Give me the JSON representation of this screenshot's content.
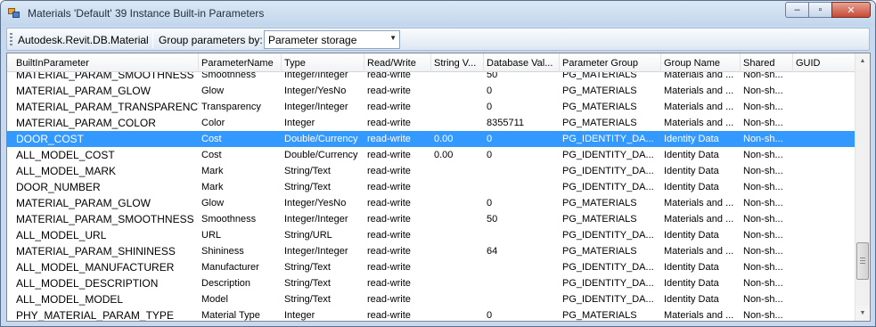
{
  "window": {
    "title": "Materials 'Default' 39 Instance Built-in Parameters",
    "minimize_glyph": "‒",
    "maximize_glyph": "▫",
    "close_glyph": "✕"
  },
  "toolbar": {
    "class_label": "Autodesk.Revit.DB.Material",
    "group_label": "Group parameters by:",
    "group_value": "Parameter storage"
  },
  "grid": {
    "columns": [
      "BuiltInParameter",
      "ParameterName",
      "Type",
      "Read/Write",
      "String V...",
      "Database Val...",
      "Parameter Group",
      "Group Name",
      "Shared",
      "GUID"
    ],
    "selected_row_index": 4,
    "rows": [
      [
        "MATERIAL_PARAM_SMOOTHNESS",
        "Smoothness",
        "Integer/Integer",
        "read-write",
        "",
        "50",
        "PG_MATERIALS",
        "Materials and ...",
        "Non-sh...",
        ""
      ],
      [
        "MATERIAL_PARAM_GLOW",
        "Glow",
        "Integer/YesNo",
        "read-write",
        "",
        "0",
        "PG_MATERIALS",
        "Materials and ...",
        "Non-sh...",
        ""
      ],
      [
        "MATERIAL_PARAM_TRANSPARENCY",
        "Transparency",
        "Integer/Integer",
        "read-write",
        "",
        "0",
        "PG_MATERIALS",
        "Materials and ...",
        "Non-sh...",
        ""
      ],
      [
        "MATERIAL_PARAM_COLOR",
        "Color",
        "Integer",
        "read-write",
        "",
        "8355711",
        "PG_MATERIALS",
        "Materials and ...",
        "Non-sh...",
        ""
      ],
      [
        "DOOR_COST",
        "Cost",
        "Double/Currency",
        "read-write",
        "0.00",
        "0",
        "PG_IDENTITY_DA...",
        "Identity Data",
        "Non-sh...",
        ""
      ],
      [
        "ALL_MODEL_COST",
        "Cost",
        "Double/Currency",
        "read-write",
        "0.00",
        "0",
        "PG_IDENTITY_DA...",
        "Identity Data",
        "Non-sh...",
        ""
      ],
      [
        "ALL_MODEL_MARK",
        "Mark",
        "String/Text",
        "read-write",
        "",
        "",
        "PG_IDENTITY_DA...",
        "Identity Data",
        "Non-sh...",
        ""
      ],
      [
        "DOOR_NUMBER",
        "Mark",
        "String/Text",
        "read-write",
        "",
        "",
        "PG_IDENTITY_DA...",
        "Identity Data",
        "Non-sh...",
        ""
      ],
      [
        "MATERIAL_PARAM_GLOW",
        "Glow",
        "Integer/YesNo",
        "read-write",
        "",
        "0",
        "PG_MATERIALS",
        "Materials and ...",
        "Non-sh...",
        ""
      ],
      [
        "MATERIAL_PARAM_SMOOTHNESS",
        "Smoothness",
        "Integer/Integer",
        "read-write",
        "",
        "50",
        "PG_MATERIALS",
        "Materials and ...",
        "Non-sh...",
        ""
      ],
      [
        "ALL_MODEL_URL",
        "URL",
        "String/URL",
        "read-write",
        "",
        "",
        "PG_IDENTITY_DA...",
        "Identity Data",
        "Non-sh...",
        ""
      ],
      [
        "MATERIAL_PARAM_SHININESS",
        "Shininess",
        "Integer/Integer",
        "read-write",
        "",
        "64",
        "PG_MATERIALS",
        "Materials and ...",
        "Non-sh...",
        ""
      ],
      [
        "ALL_MODEL_MANUFACTURER",
        "Manufacturer",
        "String/Text",
        "read-write",
        "",
        "",
        "PG_IDENTITY_DA...",
        "Identity Data",
        "Non-sh...",
        ""
      ],
      [
        "ALL_MODEL_DESCRIPTION",
        "Description",
        "String/Text",
        "read-write",
        "",
        "",
        "PG_IDENTITY_DA...",
        "Identity Data",
        "Non-sh...",
        ""
      ],
      [
        "ALL_MODEL_MODEL",
        "Model",
        "String/Text",
        "read-write",
        "",
        "",
        "PG_IDENTITY_DA...",
        "Identity Data",
        "Non-sh...",
        ""
      ],
      [
        "PHY_MATERIAL_PARAM_TYPE",
        "Material Type",
        "Integer",
        "read-write",
        "",
        "0",
        "PG_MATERIALS",
        "Materials and ...",
        "Non-sh...",
        ""
      ]
    ]
  },
  "scrollbar": {
    "up_glyph": "▲",
    "down_glyph": "▼"
  }
}
